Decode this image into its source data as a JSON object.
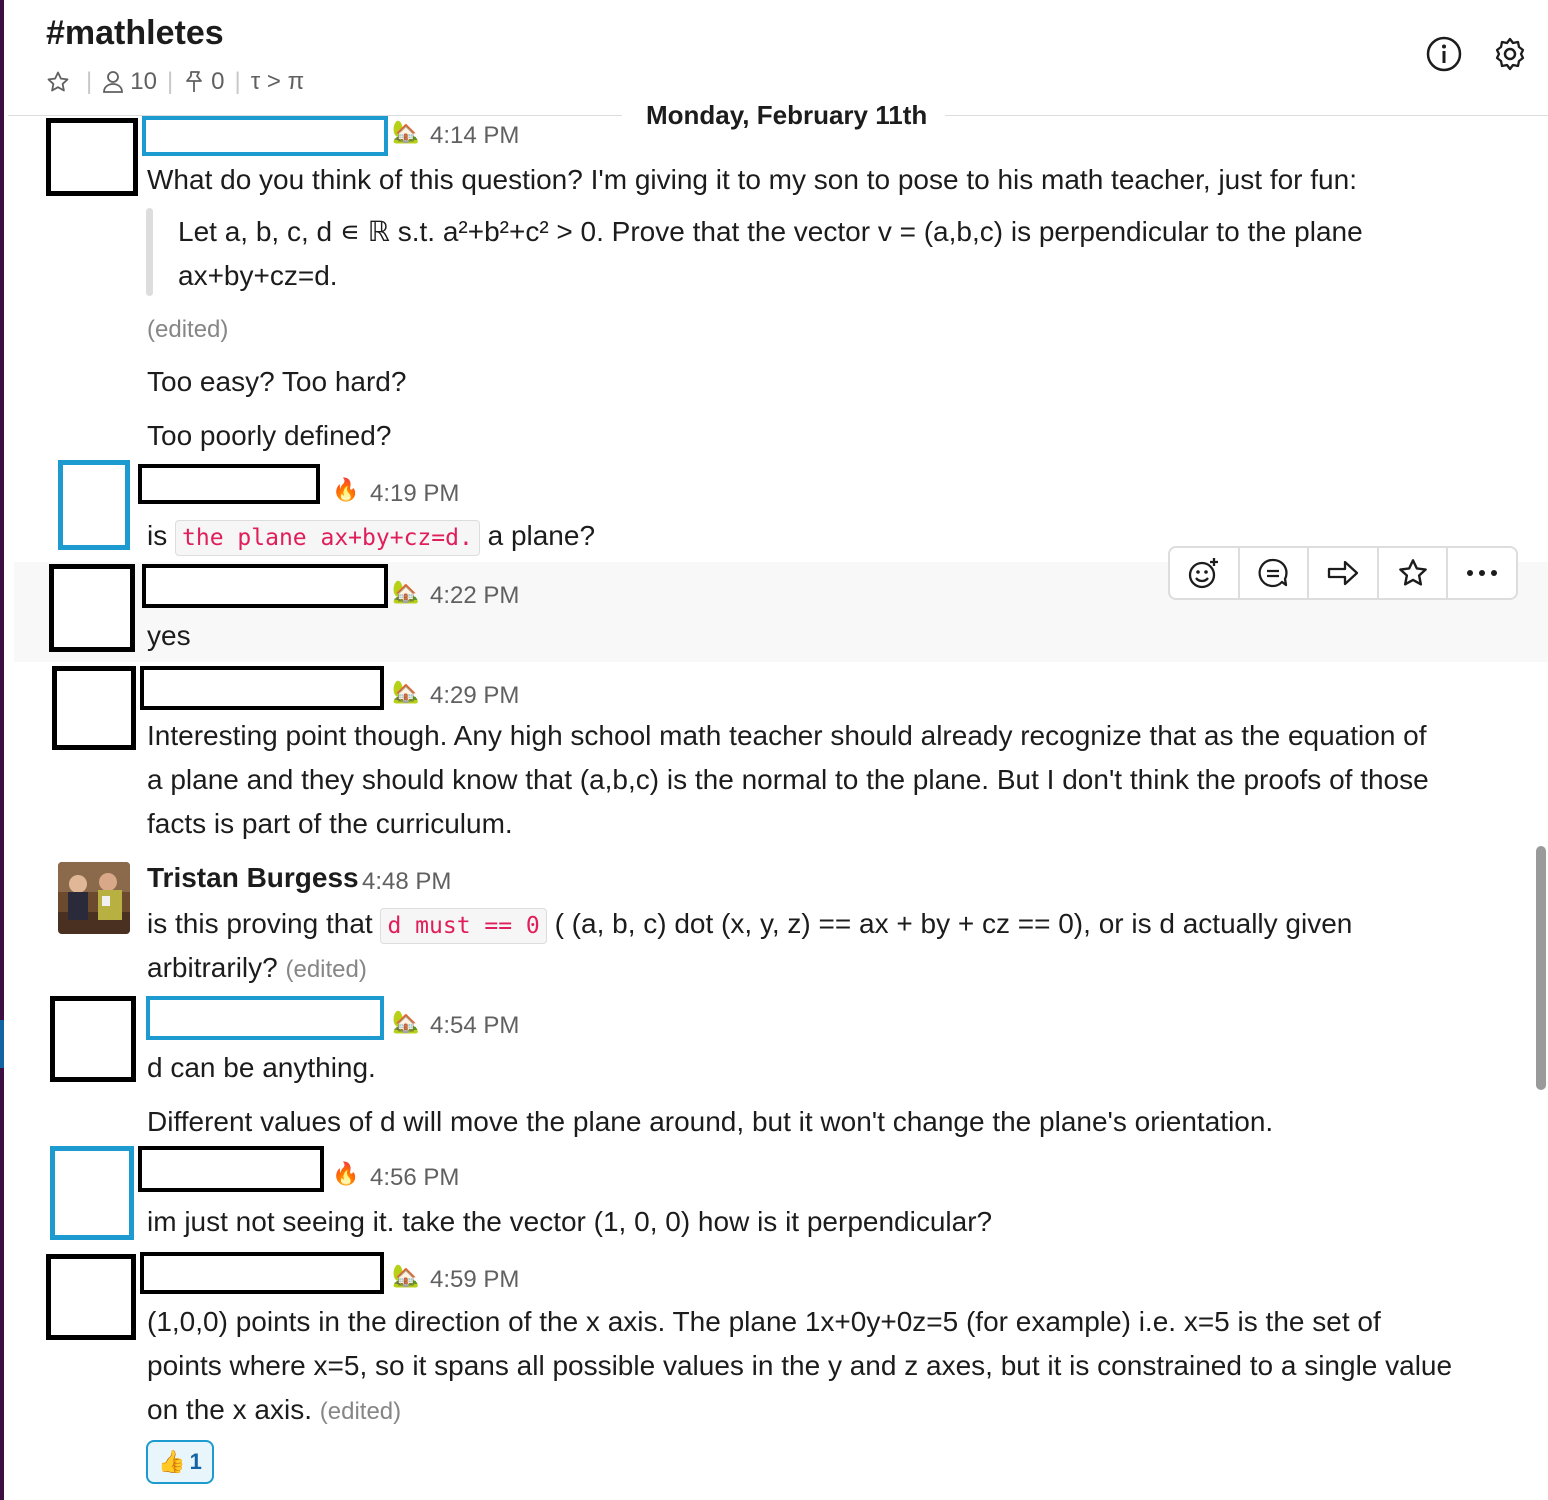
{
  "channel": {
    "name": "#mathletes",
    "member_count": "10",
    "pinned_count": "0",
    "topic": "τ > π",
    "icons": [
      "star-icon",
      "person-icon",
      "pin-icon",
      "info-icon",
      "gear-icon"
    ]
  },
  "date_divider": "Monday, February 11th",
  "messages": [
    {
      "time": "4:14 PM",
      "status_icon": "house-with-garden-emoji",
      "lines": [
        "What do you think of this question?  I'm giving it to my son to pose to his math teacher, just for fun:"
      ],
      "quote": [
        "Let a, b, c, d ∊ ℝ s.t. a²+b²+c² > 0.  Prove that the vector v = (a,b,c) is perpendicular to the plane",
        "ax+by+cz=d."
      ],
      "edited": "(edited)",
      "followups": [
        "Too easy?  Too hard?",
        "Too poorly defined?"
      ]
    },
    {
      "time": "4:19 PM",
      "status_icon": "fire-emoji",
      "text_before": "is",
      "code": "the plane ax+by+cz=d.",
      "text_after": "a plane?"
    },
    {
      "time": "4:22 PM",
      "status_icon": "house-with-garden-emoji",
      "text": "yes"
    },
    {
      "time": "4:29 PM",
      "status_icon": "house-with-garden-emoji",
      "lines": [
        "Interesting point though.  Any high school math teacher should already recognize that as the equation of",
        "a plane and they should know that (a,b,c) is the normal to the plane.  But I don't think the proofs of those",
        "facts is part of the curriculum."
      ]
    },
    {
      "author": "Tristan Burgess",
      "time": "4:48 PM",
      "text_before": "is this proving that",
      "code": "d must == 0",
      "text_after": "( (a, b, c) dot (x, y, z) == ax + by + cz == 0), or is d actually given",
      "line2": "arbitrarily?",
      "edited": "(edited)"
    },
    {
      "time": "4:54 PM",
      "status_icon": "house-with-garden-emoji",
      "lines": [
        "d can be anything.",
        "Different values of d will move the plane around, but it won't change the plane's orientation."
      ]
    },
    {
      "time": "4:56 PM",
      "status_icon": "fire-emoji",
      "text": "im just not seeing it. take the vector (1, 0, 0) how is it perpendicular?"
    },
    {
      "time": "4:59 PM",
      "status_icon": "house-with-garden-emoji",
      "lines": [
        "(1,0,0) points in the direction of the x axis.  The plane 1x+0y+0z=5 (for example) i.e. x=5 is  the set of",
        "points where x=5, so it spans all possible values in the y and z axes, but it is constrained to a single value",
        "on the x axis."
      ],
      "edited": "(edited)",
      "reaction": {
        "emoji": "👍",
        "count": "1"
      }
    }
  ],
  "hover_toolbar": [
    "add-reaction-icon",
    "reply-thread-icon",
    "share-icon",
    "star-icon",
    "more-actions-icon"
  ]
}
